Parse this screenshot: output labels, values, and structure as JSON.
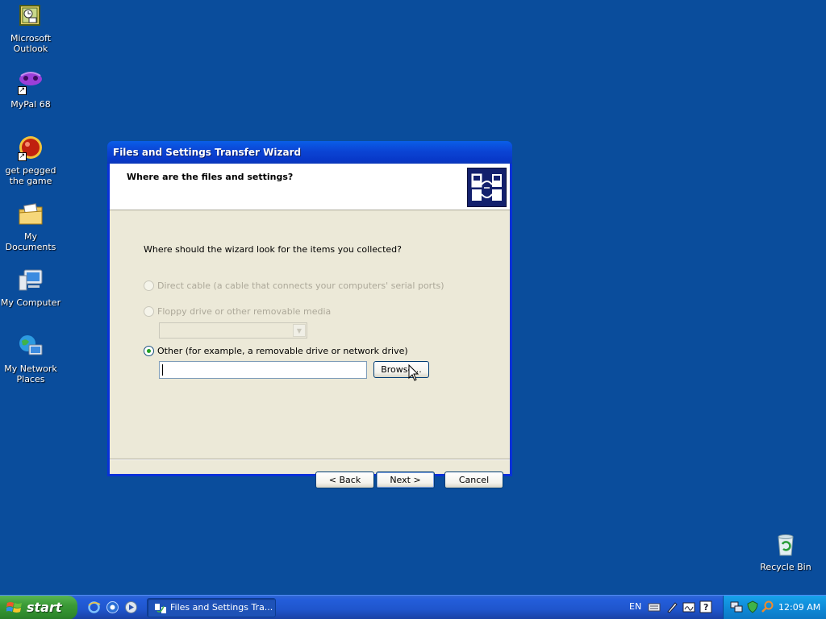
{
  "desktop": {
    "icons": [
      {
        "label": "Microsoft Outlook",
        "icon": "outlook-icon"
      },
      {
        "label": "MyPal 68",
        "icon": "mypal-icon"
      },
      {
        "label": "get pegged the game",
        "icon": "pegged-game-icon"
      },
      {
        "label": "My Documents",
        "icon": "my-documents-icon"
      },
      {
        "label": "My Computer",
        "icon": "my-computer-icon"
      },
      {
        "label": "My Network Places",
        "icon": "network-places-icon"
      },
      {
        "label": "Recycle Bin",
        "icon": "recycle-bin-icon"
      }
    ],
    "background_color": "#0a4d9c"
  },
  "wizard": {
    "title": "Files and Settings Transfer Wizard",
    "header_title": "Where are the files and settings?",
    "question": "Where should the wizard look for the items you collected?",
    "options": [
      {
        "label": "Direct cable (a cable that connects your computers' serial ports)",
        "enabled": false,
        "checked": false
      },
      {
        "label": "Floppy drive or other removable media",
        "enabled": false,
        "checked": false
      },
      {
        "label": "Other (for example, a removable drive or network drive)",
        "enabled": true,
        "checked": true
      }
    ],
    "path_value": "",
    "browse_label": "Browse...",
    "back_label": "< Back",
    "next_label": "Next >",
    "cancel_label": "Cancel"
  },
  "taskbar": {
    "start_label": "start",
    "task_label": "Files and Settings Tra...",
    "language": "EN",
    "clock": "12:09 AM"
  }
}
